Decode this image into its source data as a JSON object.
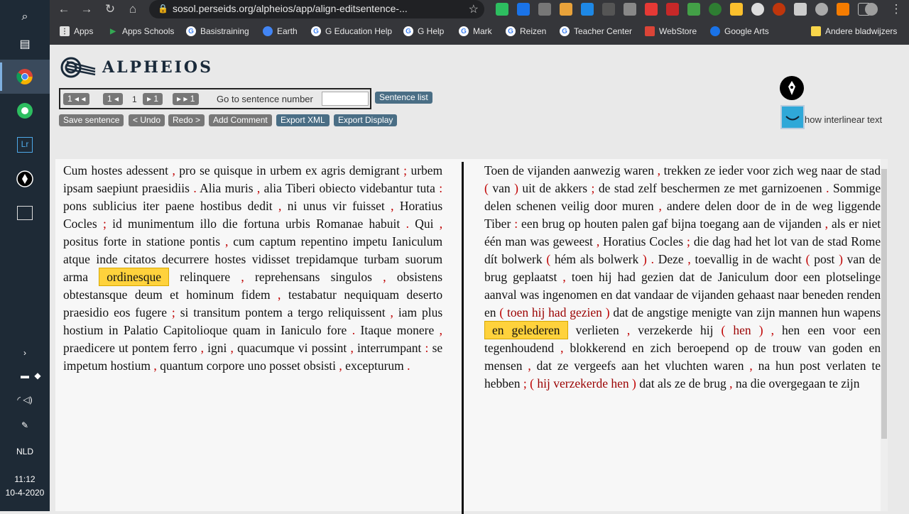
{
  "browser": {
    "url": "sosol.perseids.org/alpheios/app/align-editsentence-...",
    "bookmarks": [
      "Apps",
      "Apps Schools",
      "Basistraining",
      "Earth",
      "G Education Help",
      "G Help",
      "Mark",
      "Reizen",
      "Teacher Center",
      "WebStore",
      "Google Arts",
      "Andere bladwijzers"
    ]
  },
  "taskbar": {
    "lang": "NLD",
    "time": "11:12",
    "date": "10-4-2020"
  },
  "app": {
    "logo_text": "ALPHEIOS"
  },
  "nav": {
    "first": "1 ◂ ◂",
    "prev": "1 ◂",
    "current": "1",
    "next": "▸ 1",
    "last": "▸ ▸ 1",
    "goto_label": "Go to sentence number",
    "goto_value": "",
    "sentence_list": "Sentence list"
  },
  "toolbar": {
    "save": "Save sentence",
    "undo": "< Undo",
    "redo": "Redo >",
    "comment": "Add Comment",
    "export_xml": "Export XML",
    "export_display": "Export Display"
  },
  "interlinear_label": "how interlinear text",
  "left_text": [
    [
      "Cum",
      "hostes",
      "adessent",
      ",",
      "pro",
      "se",
      "quisque",
      "in",
      "urbem",
      "ex",
      "agris",
      "demigrant",
      ";",
      "urbem",
      "ipsam",
      "saepiunt",
      "praesidiis",
      ".",
      "Alia",
      "muris",
      ",",
      "alia",
      "Tiberi",
      "obiecto",
      "videbantur",
      "tuta",
      ":",
      "pons",
      "sublicius",
      "iter",
      "paene",
      "hostibus",
      "dedit",
      ",",
      "ni",
      "unus",
      "vir",
      "fuisset",
      ",",
      "Horatius",
      "Cocles",
      ";",
      "id",
      "munimentum",
      "illo",
      "die",
      "fortuna",
      "urbis",
      "Romanae",
      "habuit",
      ".",
      "Qui",
      ",",
      "positus",
      "forte",
      "in",
      "statione",
      "pontis",
      ",",
      "cum",
      "captum",
      "repentino",
      "impetu",
      "Ianiculum",
      "atque",
      "inde",
      "citatos",
      "decurrere",
      "hostes",
      "vidisset",
      "trepidamque",
      "turbam",
      "suorum",
      "arma",
      "ordinesque",
      "relinquere",
      ",",
      "reprehensans",
      "singulos",
      ",",
      "obsistens",
      "obtestansque",
      "deum",
      "et",
      "hominum",
      "fidem",
      ",",
      "testabatur",
      "nequiquam",
      "deserto",
      "praesidio",
      "eos",
      "fugere",
      ";",
      "si",
      "transitum",
      "pontem",
      "a",
      "tergo",
      "reliquissent",
      ",",
      "iam",
      "plus",
      "hostium",
      "in",
      "Palatio",
      "Capitolioque",
      "quam",
      "in",
      "Ianiculo",
      "fore",
      ".",
      "Itaque",
      "monere",
      ",",
      "praedicere",
      "ut",
      "pontem",
      "ferro",
      ",",
      "igni",
      ",",
      "quacumque",
      "vi",
      "possint",
      ",",
      "interrumpant",
      ":",
      "se",
      "impetum",
      "hostium",
      ",",
      "quantum",
      "corpore",
      "uno",
      "posset",
      "obsisti",
      ",",
      "excepturum",
      "."
    ]
  ],
  "left_highlight": "ordinesque",
  "right_text": [
    [
      "Toen",
      "de",
      "vijanden",
      "aanwezig",
      "waren",
      ",",
      "trekken",
      "ze",
      "ieder",
      "voor",
      "zich",
      "weg",
      "naar",
      "de",
      "stad",
      "(",
      "van",
      ")",
      "uit",
      "de",
      "akkers",
      ";",
      "de",
      "stad",
      "zelf",
      "beschermen",
      "ze",
      "met",
      "garnizoenen",
      ".",
      "Sommige",
      "delen",
      "schenen",
      "veilig",
      "door",
      "muren",
      ",",
      "andere",
      "delen",
      "door",
      "de",
      "in",
      "de",
      "weg",
      "liggende",
      "Tiber",
      ":",
      "een",
      "brug",
      "op",
      "houten",
      "palen",
      "gaf",
      "bijna",
      "toegang",
      "aan",
      "de",
      "vijanden",
      ",",
      "als",
      "er",
      "niet",
      "één",
      "man",
      "was",
      "geweest",
      ",",
      "Horatius",
      "Cocles",
      ";",
      "die",
      "dag",
      "had",
      "het",
      "lot",
      "van",
      "de",
      "stad",
      "Rome",
      "dít",
      "bolwerk",
      "(",
      "hém",
      "als",
      "bolwerk",
      ")",
      ".",
      "Deze",
      ",",
      "toevallig",
      "in",
      "de",
      "wacht",
      "(",
      "post",
      ")",
      "van",
      "de",
      "brug",
      "geplaatst",
      ",",
      "toen",
      "hij",
      "had",
      "gezien",
      "dat",
      "de",
      "Janiculum",
      "door",
      "een",
      "plotselinge",
      "aanval",
      "was",
      "ingenomen",
      "en",
      "dat",
      "vandaar",
      "de",
      "vijanden",
      "gehaast",
      "naar",
      "beneden",
      "renden",
      "en",
      "(",
      "toen",
      "hij",
      "had",
      "gezien",
      ")",
      "dat",
      "de",
      "angstige",
      "menigte",
      "van",
      "zijn",
      "mannen",
      "hun",
      "wapens",
      "en gelederen",
      "verlieten",
      ",",
      "verzekerde",
      "hij",
      "(",
      "hen",
      ")",
      ",",
      "hen",
      "een",
      "voor",
      "een",
      "tegenhoudend",
      ",",
      "blokkerend",
      "en",
      "zich",
      "beroepend",
      "op",
      "de",
      "trouw",
      "van",
      "goden",
      "en",
      "mensen",
      ",",
      "dat",
      "ze",
      "vergeefs",
      "aan",
      "het",
      "vluchten",
      "waren",
      ",",
      "na",
      "hun",
      "post",
      "verlaten",
      "te",
      "hebben",
      ";",
      "(",
      "hij",
      "verzekerde",
      "hen",
      ")",
      "dat",
      "als",
      "ze",
      "de",
      "brug",
      ",",
      "na",
      "die",
      "overgegaan",
      "te",
      "zijn"
    ]
  ],
  "right_highlight": "en gelederen",
  "right_red_words": [
    "toen",
    "hij",
    "had",
    "gezien",
    "hen",
    "verzekerde"
  ],
  "colors": {
    "highlight": "#ffd23c",
    "punct": "#c00000",
    "button_grey": "#777777",
    "button_blue": "#4a6e85"
  }
}
